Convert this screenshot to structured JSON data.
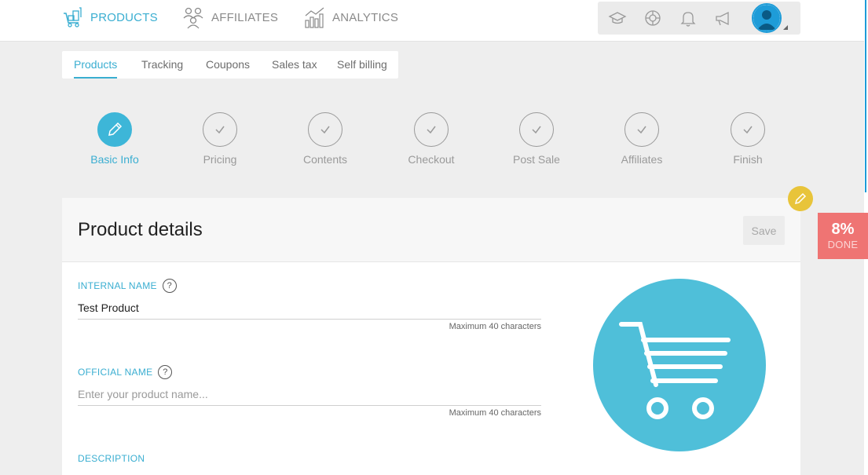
{
  "nav": {
    "items": [
      {
        "label": "PRODUCTS",
        "icon": "cart-icon",
        "active": true
      },
      {
        "label": "AFFILIATES",
        "icon": "people-icon",
        "active": false
      },
      {
        "label": "ANALYTICS",
        "icon": "bar-chart-icon",
        "active": false
      }
    ],
    "tools": [
      "graduation-cap-icon",
      "lifebuoy-icon",
      "bell-icon",
      "megaphone-icon"
    ]
  },
  "subtabs": [
    {
      "label": "Products",
      "active": true
    },
    {
      "label": "Tracking",
      "active": false
    },
    {
      "label": "Coupons",
      "active": false
    },
    {
      "label": "Sales tax",
      "active": false
    },
    {
      "label": "Self billing",
      "active": false
    }
  ],
  "steps": [
    {
      "label": "Basic Info",
      "active": true
    },
    {
      "label": "Pricing",
      "active": false
    },
    {
      "label": "Contents",
      "active": false
    },
    {
      "label": "Checkout",
      "active": false
    },
    {
      "label": "Post Sale",
      "active": false
    },
    {
      "label": "Affiliates",
      "active": false
    },
    {
      "label": "Finish",
      "active": false
    }
  ],
  "card": {
    "title": "Product details",
    "save_label": "Save"
  },
  "fields": {
    "internal_name": {
      "label": "INTERNAL NAME",
      "value": "Test Product",
      "hint": "Maximum 40 characters"
    },
    "official_name": {
      "label": "OFFICIAL NAME",
      "placeholder": "Enter your product name...",
      "hint": "Maximum 40 characters"
    },
    "description": {
      "label": "DESCRIPTION"
    },
    "help_glyph": "?"
  },
  "progress": {
    "value": "8%",
    "label": "DONE"
  },
  "colors": {
    "accent": "#3aaed1",
    "progress_badge": "#ef7473",
    "edit_badge": "#e8c43a",
    "product_image": "#4fbfd9"
  }
}
